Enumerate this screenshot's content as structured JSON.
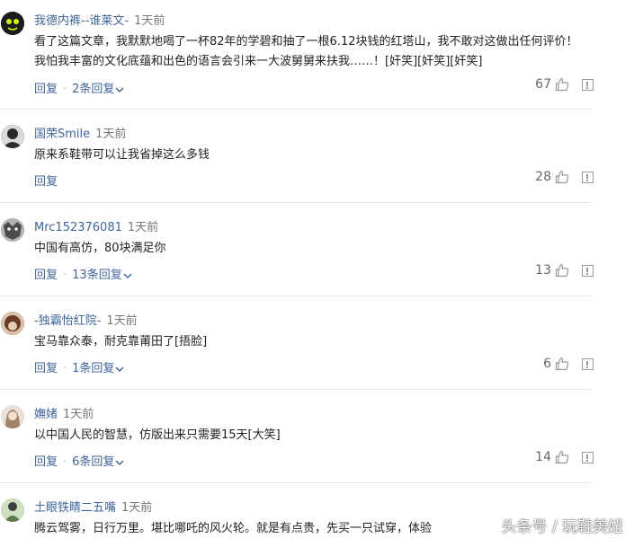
{
  "comments": [
    {
      "username": "我德内裤--谁莱文-",
      "time": "1天前",
      "text": "看了这篇文章，我默默地喝了一杯82年的学碧和抽了一根6.12块钱的红塔山，我不敢对这做出任何评价！我怕我丰富的文化底蕴和出色的语言会引来一大波舅舅来扶我……！[奸笑][奸笑][奸笑]",
      "reply_label": "回复",
      "replies_label": "2条回复",
      "likes": "67",
      "avatar_color": "#1c1c1c"
    },
    {
      "username": "国荣Smile",
      "time": "1天前",
      "text": "原来系鞋带可以让我省掉这么多钱",
      "reply_label": "回复",
      "replies_label": "",
      "likes": "28",
      "avatar_color": "#2a2a2a"
    },
    {
      "username": "Mrc152376081",
      "time": "1天前",
      "text": "中国有高仿，80块满足你",
      "reply_label": "回复",
      "replies_label": "13条回复",
      "likes": "13",
      "avatar_color": "#8a8a8a"
    },
    {
      "username": "-独霸怡红院-",
      "time": "1天前",
      "text": "宝马靠众泰，耐克靠莆田了[捂脸]",
      "reply_label": "回复",
      "replies_label": "1条回复",
      "likes": "6",
      "avatar_color": "#6b3a2a"
    },
    {
      "username": "嫵媎",
      "time": "1天前",
      "text": "以中国人民的智慧，仿版出来只需要15天[大笑]",
      "reply_label": "回复",
      "replies_label": "6条回复",
      "likes": "14",
      "avatar_color": "#c9b8a6"
    },
    {
      "username": "土眼铁睛二五嘴",
      "time": "1天前",
      "text": "腾云驾雾，日行万里。堪比哪吒的风火轮。就是有点贵，先买一只试穿，体验",
      "reply_label": "",
      "replies_label": "",
      "likes": "",
      "avatar_color": "#5a7a4a"
    }
  ],
  "watermark": "头条号 / 玩鞋美妞",
  "colors": {
    "link": "#406599",
    "text": "#222222",
    "divider": "#e8e8e8"
  }
}
